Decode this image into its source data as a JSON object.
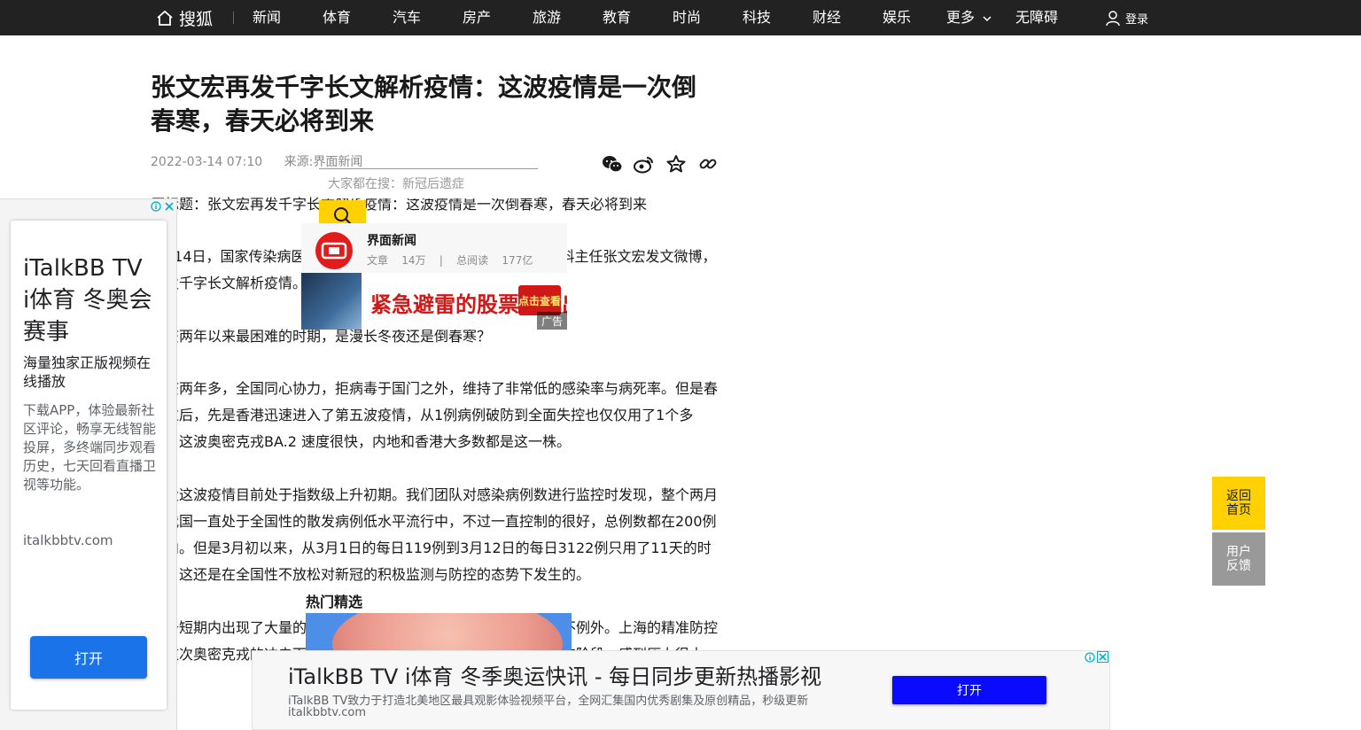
{
  "topnav": {
    "logo_text": "搜狐",
    "items": [
      "新闻",
      "体育",
      "汽车",
      "房产",
      "旅游",
      "教育",
      "时尚",
      "科技",
      "财经",
      "娱乐",
      "更多",
      "无障碍"
    ],
    "login_label": "登录"
  },
  "article": {
    "title": "张文宏再发千字长文解析疫情：这波疫情是一次倒春寒，春天必将到来",
    "date": "2022-03-14 07:10",
    "source": "来源:界面新闻",
    "paragraphs": [
      "原标题：张文宏再发千字长文解析疫情：这波疫情是一次倒春寒，春天必将到来",
      "3月14日，国家传染病医学中心主任、复旦大学附属华山医院感染科主任张文宏发文微博，再发千字长文解析疫情。",
      "抗疫两年以来最困难的时期，是漫长冬夜还是倒春寒？",
      "抗疫两年多，全国同心协力，拒病毒于国门之外，维持了非常低的感染率与病死率。但是春节过后，先是香港迅速进入了第五波疫情，从1例病例破防到全面失控也仅仅用了1个多月。这波奥密克戎BA.2 速度很快，内地和香港大多数都是这一株。",
      "从大这波疫情目前处于指数级上升初期。我们团队对感染病例数进行监控时发现，整个两月内我国一直处于全国性的散发病例低水平流行中，不过一直控制的很好，总例数都在200例以内。但是3月初以来，从3月1日的每日119例到3月12日的每日3122例只用了11天的时间，这还是在全国性不放松对新冠的积极监测与防控的态势下发生的。",
      "由于短期内出现了大量的病例，各地的防控压力都在增加，上海也不例外。上海的精准防控在这次奥密克戎的冲击下同样面临着严峻考验，当前正处在最关键的阶段，感到压力很大。"
    ]
  },
  "search_popup": {
    "placeholder": "大家都在搜：新冠后遗症",
    "author_name": "界面新闻",
    "stats": [
      "文章",
      "14万",
      "|",
      "总阅读",
      "177亿"
    ],
    "ad_text": "紧急避雷的股票名单出来了",
    "ad_cta": "点击查看",
    "ad_tag": "广告"
  },
  "left_ad": {
    "headline": "iTalkBB TV i体育 冬奥会赛事",
    "subhead": "海量独家正版视频在线播放",
    "description": "下载APP，体验最新社区评论，畅享无线智能投屏，多终端同步观看历史，七天回看直播卫视等功能。",
    "url": "italkbbtv.com",
    "button": "打开"
  },
  "hot": {
    "title": "热门精选"
  },
  "bottom_ad": {
    "title": "iTalkBB TV i体育 冬季奥运快讯 - 每日同步更新热播影视",
    "description": "iTalkBB TV致力于打造北美地区最具观影体验视频平台，全网汇集国内优秀剧集及原创精品，秒级更新",
    "url": "italkbbtv.com",
    "button": "打开"
  },
  "side": {
    "top_line1": "返回",
    "top_line2": "首页",
    "fb_line1": "用户",
    "fb_line2": "反馈"
  },
  "colors": {
    "nav_bg": "#222222",
    "accent_yellow": "#ffd100",
    "ad_blue": "#1a73e8"
  },
  "icons": [
    "home-icon",
    "chevron-down-icon",
    "user-icon",
    "wechat-icon",
    "weibo-icon",
    "star-icon",
    "link-icon",
    "search-icon",
    "adchoices-icon",
    "close-icon"
  ]
}
